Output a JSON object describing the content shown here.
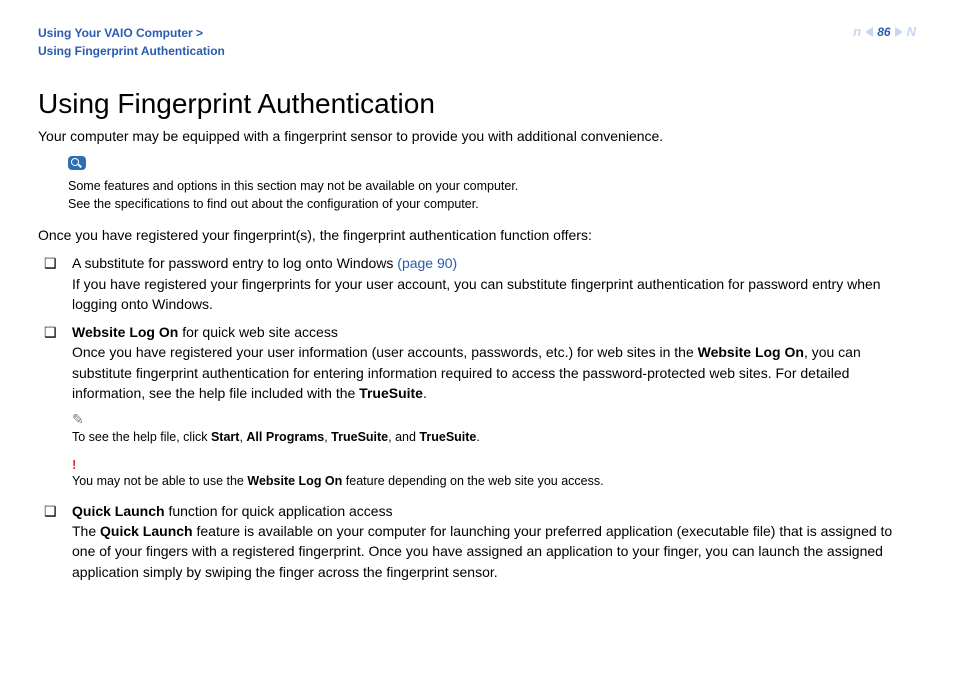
{
  "header": {
    "breadcrumb_parent": "Using Your VAIO Computer >",
    "breadcrumb_current": "Using Fingerprint Authentication",
    "page_number": "86",
    "nav_n": "n",
    "nav_N": "N"
  },
  "title": "Using Fingerprint Authentication",
  "intro": "Your computer may be equipped with a fingerprint sensor to provide you with additional convenience.",
  "availability_note": {
    "line1": "Some features and options in this section may not be available on your computer.",
    "line2": "See the specifications to find out about the configuration of your computer."
  },
  "registered_intro": "Once you have registered your fingerprint(s), the fingerprint authentication function offers:",
  "bullets": {
    "b1": {
      "lead": "A substitute for password entry to log onto Windows ",
      "link": "(page 90)",
      "body": "If you have registered your fingerprints for your user account, you can substitute fingerprint authentication for password entry when logging onto Windows."
    },
    "b2": {
      "bold": "Website Log On",
      "after_bold": " for quick web site access",
      "body_pre": "Once you have registered your user information (user accounts, passwords, etc.) for web sites in the ",
      "body_bold1": "Website Log On",
      "body_mid": ", you can substitute fingerprint authentication for entering information required to access the password-protected web sites. For detailed information, see the help file included with the ",
      "body_bold2": "TrueSuite",
      "body_end": "."
    },
    "b3": {
      "bold": "Quick Launch",
      "after_bold": " function for quick application access",
      "body_pre": "The ",
      "body_bold": "Quick Launch",
      "body_post": " feature is available on your computer for launching your preferred application (executable file) that is assigned to one of your fingers with a registered fingerprint. Once you have assigned an application to your finger, you can launch the assigned application simply by swiping the finger across the fingerprint sensor."
    }
  },
  "helpfile_note": {
    "pre": "To see the help file, click ",
    "s1": "Start",
    "c1": ", ",
    "s2": "All Programs",
    "c2": ", ",
    "s3": "TrueSuite",
    "c3": ", and ",
    "s4": "TrueSuite",
    "end": "."
  },
  "warning_note": {
    "pre": "You may not be able to use the ",
    "bold": "Website Log On",
    "post": " feature depending on the web site you access."
  }
}
